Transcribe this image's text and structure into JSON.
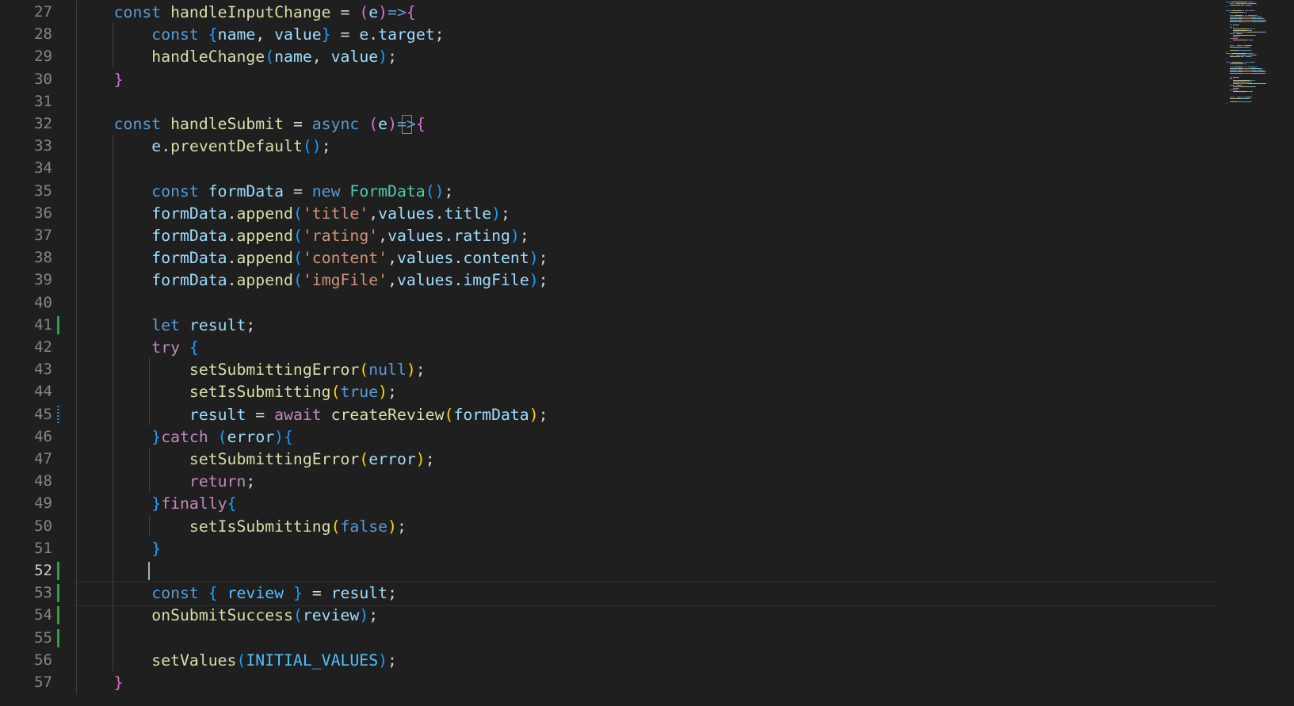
{
  "editor": {
    "active_line": "52",
    "lines": [
      {
        "num": "27",
        "tokens": [
          {
            "t": "    ",
            "c": "pun"
          },
          {
            "t": "const",
            "c": "kw"
          },
          {
            "t": " ",
            "c": "pun"
          },
          {
            "t": "handleInputChange",
            "c": "fn"
          },
          {
            "t": " = ",
            "c": "pun"
          },
          {
            "t": "(",
            "c": "br2"
          },
          {
            "t": "e",
            "c": "var"
          },
          {
            "t": ")",
            "c": "br2"
          },
          {
            "t": "=>",
            "c": "kw"
          },
          {
            "t": "{",
            "c": "br2"
          }
        ]
      },
      {
        "num": "28",
        "tokens": [
          {
            "t": "        ",
            "c": "pun"
          },
          {
            "t": "const",
            "c": "kw"
          },
          {
            "t": " ",
            "c": "pun"
          },
          {
            "t": "{",
            "c": "br3"
          },
          {
            "t": "name",
            "c": "var"
          },
          {
            "t": ", ",
            "c": "pun"
          },
          {
            "t": "value",
            "c": "var"
          },
          {
            "t": "}",
            "c": "br3"
          },
          {
            "t": " = ",
            "c": "pun"
          },
          {
            "t": "e",
            "c": "var"
          },
          {
            "t": ".",
            "c": "pun"
          },
          {
            "t": "target",
            "c": "var"
          },
          {
            "t": ";",
            "c": "pun"
          }
        ]
      },
      {
        "num": "29",
        "tokens": [
          {
            "t": "        ",
            "c": "pun"
          },
          {
            "t": "handleChange",
            "c": "fn"
          },
          {
            "t": "(",
            "c": "br3"
          },
          {
            "t": "name",
            "c": "var"
          },
          {
            "t": ", ",
            "c": "pun"
          },
          {
            "t": "value",
            "c": "var"
          },
          {
            "t": ")",
            "c": "br3"
          },
          {
            "t": ";",
            "c": "pun"
          }
        ]
      },
      {
        "num": "30",
        "tokens": [
          {
            "t": "    ",
            "c": "pun"
          },
          {
            "t": "}",
            "c": "br2"
          }
        ]
      },
      {
        "num": "31",
        "tokens": []
      },
      {
        "num": "32",
        "tokens": [
          {
            "t": "    ",
            "c": "pun"
          },
          {
            "t": "const",
            "c": "kw"
          },
          {
            "t": " ",
            "c": "pun"
          },
          {
            "t": "handleSubmit",
            "c": "fn"
          },
          {
            "t": " = ",
            "c": "pun"
          },
          {
            "t": "async",
            "c": "kw"
          },
          {
            "t": " ",
            "c": "pun"
          },
          {
            "t": "(",
            "c": "br2"
          },
          {
            "t": "e",
            "c": "var"
          },
          {
            "t": ")",
            "c": "br2"
          },
          {
            "t": "=>",
            "c": "kw"
          },
          {
            "t": "{",
            "c": "br2"
          }
        ]
      },
      {
        "num": "33",
        "tokens": [
          {
            "t": "        ",
            "c": "pun"
          },
          {
            "t": "e",
            "c": "var"
          },
          {
            "t": ".",
            "c": "pun"
          },
          {
            "t": "preventDefault",
            "c": "fn"
          },
          {
            "t": "()",
            "c": "br3"
          },
          {
            "t": ";",
            "c": "pun"
          }
        ]
      },
      {
        "num": "34",
        "tokens": []
      },
      {
        "num": "35",
        "tokens": [
          {
            "t": "        ",
            "c": "pun"
          },
          {
            "t": "const",
            "c": "kw"
          },
          {
            "t": " ",
            "c": "pun"
          },
          {
            "t": "formData",
            "c": "var"
          },
          {
            "t": " = ",
            "c": "pun"
          },
          {
            "t": "new",
            "c": "kw"
          },
          {
            "t": " ",
            "c": "pun"
          },
          {
            "t": "FormData",
            "c": "cls"
          },
          {
            "t": "()",
            "c": "br3"
          },
          {
            "t": ";",
            "c": "pun"
          }
        ]
      },
      {
        "num": "36",
        "tokens": [
          {
            "t": "        ",
            "c": "pun"
          },
          {
            "t": "formData",
            "c": "var"
          },
          {
            "t": ".",
            "c": "pun"
          },
          {
            "t": "append",
            "c": "fn"
          },
          {
            "t": "(",
            "c": "br3"
          },
          {
            "t": "'title'",
            "c": "str"
          },
          {
            "t": ",",
            "c": "pun"
          },
          {
            "t": "values",
            "c": "var"
          },
          {
            "t": ".",
            "c": "pun"
          },
          {
            "t": "title",
            "c": "var"
          },
          {
            "t": ")",
            "c": "br3"
          },
          {
            "t": ";",
            "c": "pun"
          }
        ]
      },
      {
        "num": "37",
        "tokens": [
          {
            "t": "        ",
            "c": "pun"
          },
          {
            "t": "formData",
            "c": "var"
          },
          {
            "t": ".",
            "c": "pun"
          },
          {
            "t": "append",
            "c": "fn"
          },
          {
            "t": "(",
            "c": "br3"
          },
          {
            "t": "'rating'",
            "c": "str"
          },
          {
            "t": ",",
            "c": "pun"
          },
          {
            "t": "values",
            "c": "var"
          },
          {
            "t": ".",
            "c": "pun"
          },
          {
            "t": "rating",
            "c": "var"
          },
          {
            "t": ")",
            "c": "br3"
          },
          {
            "t": ";",
            "c": "pun"
          }
        ]
      },
      {
        "num": "38",
        "tokens": [
          {
            "t": "        ",
            "c": "pun"
          },
          {
            "t": "formData",
            "c": "var"
          },
          {
            "t": ".",
            "c": "pun"
          },
          {
            "t": "append",
            "c": "fn"
          },
          {
            "t": "(",
            "c": "br3"
          },
          {
            "t": "'content'",
            "c": "str"
          },
          {
            "t": ",",
            "c": "pun"
          },
          {
            "t": "values",
            "c": "var"
          },
          {
            "t": ".",
            "c": "pun"
          },
          {
            "t": "content",
            "c": "var"
          },
          {
            "t": ")",
            "c": "br3"
          },
          {
            "t": ";",
            "c": "pun"
          }
        ]
      },
      {
        "num": "39",
        "tokens": [
          {
            "t": "        ",
            "c": "pun"
          },
          {
            "t": "formData",
            "c": "var"
          },
          {
            "t": ".",
            "c": "pun"
          },
          {
            "t": "append",
            "c": "fn"
          },
          {
            "t": "(",
            "c": "br3"
          },
          {
            "t": "'imgFile'",
            "c": "str"
          },
          {
            "t": ",",
            "c": "pun"
          },
          {
            "t": "values",
            "c": "var"
          },
          {
            "t": ".",
            "c": "pun"
          },
          {
            "t": "imgFile",
            "c": "var"
          },
          {
            "t": ")",
            "c": "br3"
          },
          {
            "t": ";",
            "c": "pun"
          }
        ]
      },
      {
        "num": "40",
        "tokens": []
      },
      {
        "num": "41",
        "tokens": [
          {
            "t": "        ",
            "c": "pun"
          },
          {
            "t": "let",
            "c": "kw"
          },
          {
            "t": " ",
            "c": "pun"
          },
          {
            "t": "result",
            "c": "var"
          },
          {
            "t": ";",
            "c": "pun"
          }
        ]
      },
      {
        "num": "42",
        "tokens": [
          {
            "t": "        ",
            "c": "pun"
          },
          {
            "t": "try",
            "c": "ctl"
          },
          {
            "t": " ",
            "c": "pun"
          },
          {
            "t": "{",
            "c": "br3"
          }
        ]
      },
      {
        "num": "43",
        "tokens": [
          {
            "t": "            ",
            "c": "pun"
          },
          {
            "t": "setSubmittingError",
            "c": "fn"
          },
          {
            "t": "(",
            "c": "br1"
          },
          {
            "t": "null",
            "c": "kw"
          },
          {
            "t": ")",
            "c": "br1"
          },
          {
            "t": ";",
            "c": "pun"
          }
        ]
      },
      {
        "num": "44",
        "tokens": [
          {
            "t": "            ",
            "c": "pun"
          },
          {
            "t": "setIsSubmitting",
            "c": "fn"
          },
          {
            "t": "(",
            "c": "br1"
          },
          {
            "t": "true",
            "c": "kw"
          },
          {
            "t": ")",
            "c": "br1"
          },
          {
            "t": ";",
            "c": "pun"
          }
        ]
      },
      {
        "num": "45",
        "tokens": [
          {
            "t": "            ",
            "c": "pun"
          },
          {
            "t": "result",
            "c": "var"
          },
          {
            "t": " = ",
            "c": "pun"
          },
          {
            "t": "await",
            "c": "ctl"
          },
          {
            "t": " ",
            "c": "pun"
          },
          {
            "t": "createReview",
            "c": "fn"
          },
          {
            "t": "(",
            "c": "br1"
          },
          {
            "t": "formData",
            "c": "var"
          },
          {
            "t": ")",
            "c": "br1"
          },
          {
            "t": ";",
            "c": "pun"
          }
        ]
      },
      {
        "num": "46",
        "tokens": [
          {
            "t": "        ",
            "c": "pun"
          },
          {
            "t": "}",
            "c": "br3"
          },
          {
            "t": "catch",
            "c": "ctl"
          },
          {
            "t": " ",
            "c": "pun"
          },
          {
            "t": "(",
            "c": "br3"
          },
          {
            "t": "error",
            "c": "var"
          },
          {
            "t": ")",
            "c": "br3"
          },
          {
            "t": "{",
            "c": "br3"
          }
        ]
      },
      {
        "num": "47",
        "tokens": [
          {
            "t": "            ",
            "c": "pun"
          },
          {
            "t": "setSubmittingError",
            "c": "fn"
          },
          {
            "t": "(",
            "c": "br1"
          },
          {
            "t": "error",
            "c": "var"
          },
          {
            "t": ")",
            "c": "br1"
          },
          {
            "t": ";",
            "c": "pun"
          }
        ]
      },
      {
        "num": "48",
        "tokens": [
          {
            "t": "            ",
            "c": "pun"
          },
          {
            "t": "return",
            "c": "ctl"
          },
          {
            "t": ";",
            "c": "pun"
          }
        ]
      },
      {
        "num": "49",
        "tokens": [
          {
            "t": "        ",
            "c": "pun"
          },
          {
            "t": "}",
            "c": "br3"
          },
          {
            "t": "finally",
            "c": "ctl"
          },
          {
            "t": "{",
            "c": "br3"
          }
        ]
      },
      {
        "num": "50",
        "tokens": [
          {
            "t": "            ",
            "c": "pun"
          },
          {
            "t": "setIsSubmitting",
            "c": "fn"
          },
          {
            "t": "(",
            "c": "br1"
          },
          {
            "t": "false",
            "c": "kw"
          },
          {
            "t": ")",
            "c": "br1"
          },
          {
            "t": ";",
            "c": "pun"
          }
        ]
      },
      {
        "num": "51",
        "tokens": [
          {
            "t": "        ",
            "c": "pun"
          },
          {
            "t": "}",
            "c": "br3"
          }
        ]
      },
      {
        "num": "52",
        "tokens": [
          {
            "t": "        ",
            "c": "pun"
          }
        ]
      },
      {
        "num": "53",
        "tokens": [
          {
            "t": "        ",
            "c": "pun"
          },
          {
            "t": "const",
            "c": "kw"
          },
          {
            "t": " ",
            "c": "pun"
          },
          {
            "t": "{",
            "c": "br3"
          },
          {
            "t": " ",
            "c": "pun"
          },
          {
            "t": "review",
            "c": "con"
          },
          {
            "t": " ",
            "c": "pun"
          },
          {
            "t": "}",
            "c": "br3"
          },
          {
            "t": " = ",
            "c": "pun"
          },
          {
            "t": "result",
            "c": "var"
          },
          {
            "t": ";",
            "c": "pun"
          }
        ]
      },
      {
        "num": "54",
        "tokens": [
          {
            "t": "        ",
            "c": "pun"
          },
          {
            "t": "onSubmitSuccess",
            "c": "fn"
          },
          {
            "t": "(",
            "c": "br3"
          },
          {
            "t": "review",
            "c": "var"
          },
          {
            "t": ")",
            "c": "br3"
          },
          {
            "t": ";",
            "c": "pun"
          }
        ]
      },
      {
        "num": "55",
        "tokens": []
      },
      {
        "num": "56",
        "tokens": [
          {
            "t": "        ",
            "c": "pun"
          },
          {
            "t": "setValues",
            "c": "fn"
          },
          {
            "t": "(",
            "c": "br3"
          },
          {
            "t": "INITIAL_VALUES",
            "c": "con"
          },
          {
            "t": ")",
            "c": "br3"
          },
          {
            "t": ";",
            "c": "pun"
          }
        ]
      },
      {
        "num": "57",
        "tokens": [
          {
            "t": "    ",
            "c": "pun"
          },
          {
            "t": "}",
            "c": "br2"
          }
        ]
      }
    ],
    "gutter_changes": {
      "41": "added",
      "45": "modified",
      "52": "added",
      "53": "added",
      "54": "added",
      "55": "added"
    },
    "colors": {
      "background": "#1f1f1f",
      "line_number": "#858585",
      "active_line_number": "#cccccc",
      "keyword": "#569cd6",
      "control": "#c586c0",
      "function": "#dcdcaa",
      "variable": "#9cdcfe",
      "class": "#4ec9b0",
      "string": "#ce9178",
      "constant": "#4fc1ff",
      "added": "#2ea043",
      "modified": "#1b81a8"
    }
  }
}
